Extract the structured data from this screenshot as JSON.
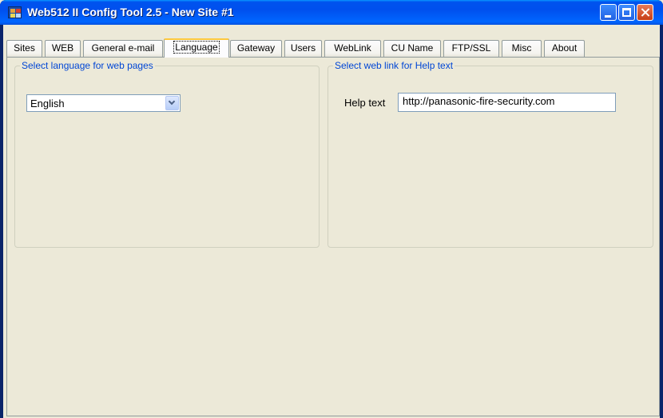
{
  "window": {
    "title": "Web512 II Config Tool 2.5 - New Site #1",
    "icon": "app-icon"
  },
  "tabs": [
    {
      "label": "Sites"
    },
    {
      "label": "WEB"
    },
    {
      "label": "General e-mail"
    },
    {
      "label": "Language",
      "active": true
    },
    {
      "label": "Gateway"
    },
    {
      "label": "Users"
    },
    {
      "label": "WebLink"
    },
    {
      "label": "CU Name"
    },
    {
      "label": "FTP/SSL"
    },
    {
      "label": "Misc"
    },
    {
      "label": "About"
    }
  ],
  "language_group": {
    "title": "Select language for web pages",
    "selected_language": "English"
  },
  "weblink_group": {
    "title": "Select web link for Help text",
    "help_label": "Help text",
    "help_url": "http://panasonic-fire-security.com"
  }
}
